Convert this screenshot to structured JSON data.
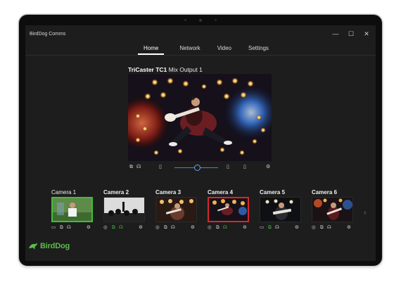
{
  "app": {
    "title": "BirdDog Comms"
  },
  "window_controls": {
    "minimize": "—",
    "maximize": "☐",
    "close": "✕"
  },
  "tabs": [
    {
      "label": "Home",
      "active": true
    },
    {
      "label": "Network",
      "active": false
    },
    {
      "label": "Video",
      "active": false
    },
    {
      "label": "Settings",
      "active": false
    }
  ],
  "main": {
    "source_name": "TriCaster TC1",
    "source_output": "Mix Output 1",
    "volume_level": 0.47
  },
  "cameras": [
    {
      "label": "Camera 1",
      "state": "preview",
      "border": "#3fbf3a"
    },
    {
      "label": "Camera 2",
      "state": "idle"
    },
    {
      "label": "Camera 3",
      "state": "idle"
    },
    {
      "label": "Camera 4",
      "state": "program",
      "border": "#d9262b"
    },
    {
      "label": "Camera 5",
      "state": "idle"
    },
    {
      "label": "Camera 6",
      "state": "idle"
    }
  ],
  "brand": {
    "logo_text": "BirdDog",
    "accent": "#5cbc4a"
  },
  "icons": {
    "copy": "copy-icon",
    "headphones": "headphones-icon",
    "phone": "phone-icon",
    "gear": "gear-icon",
    "eye": "eye-icon",
    "battery": "battery-icon",
    "next": "chevron-right-icon"
  }
}
